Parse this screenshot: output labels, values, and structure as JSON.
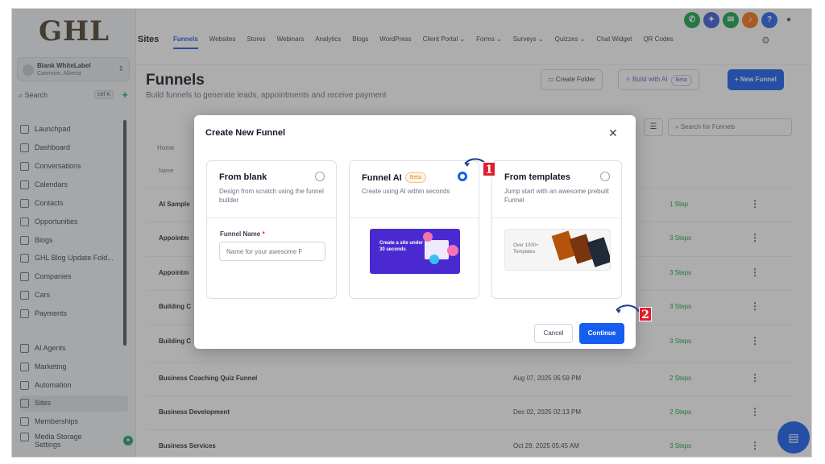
{
  "logo": "GHL",
  "account": {
    "name": "Blank WhiteLabel",
    "location": "Canmore, Alberta"
  },
  "sidebar_search": {
    "label": "Search",
    "shortcut": "ctrl K"
  },
  "sidebar": {
    "items": [
      {
        "label": "Launchpad"
      },
      {
        "label": "Dashboard"
      },
      {
        "label": "Conversations"
      },
      {
        "label": "Calendars"
      },
      {
        "label": "Contacts"
      },
      {
        "label": "Opportunities"
      },
      {
        "label": "Blogs"
      },
      {
        "label": "GHL Blog Update Fold..."
      },
      {
        "label": "Companies"
      },
      {
        "label": "Cars"
      },
      {
        "label": "Payments"
      },
      {
        "label": "AI Agents"
      },
      {
        "label": "Marketing"
      },
      {
        "label": "Automation"
      },
      {
        "label": "Sites"
      },
      {
        "label": "Memberships"
      },
      {
        "label": "Media Storage"
      },
      {
        "label": "Settings"
      }
    ]
  },
  "topbar": {
    "section": "Sites",
    "tabs": [
      "Funnels",
      "Websites",
      "Stores",
      "Webinars",
      "Analytics",
      "Blogs",
      "WordPress",
      "Client Portal ⌄",
      "Forms ⌄",
      "Surveys ⌄",
      "Quizzes ⌄",
      "Chat Widget",
      "QR Codes"
    ],
    "icons": [
      {
        "name": "phone",
        "glyph": "✆",
        "color": "#16a34a"
      },
      {
        "name": "sparkle",
        "glyph": "✦",
        "color": "#3b5bdb"
      },
      {
        "name": "megaphone",
        "glyph": "✉",
        "color": "#16a34a"
      },
      {
        "name": "bell",
        "glyph": "♪",
        "color": "#f97316"
      },
      {
        "name": "help",
        "glyph": "?",
        "color": "#2563eb"
      },
      {
        "name": "user",
        "glyph": "●",
        "color": "#4b5563"
      }
    ]
  },
  "page": {
    "title": "Funnels",
    "subtitle": "Build funnels to generate leads, appointments and receive payment",
    "create_folder": "Create Folder",
    "build_ai": "Build with AI",
    "build_ai_badge": "Beta",
    "new_funnel": "+ New Funnel",
    "search_placeholder": "Search for Funnels",
    "breadcrumb": "Home",
    "col_name": "Name"
  },
  "rows": [
    {
      "name": "AI Sample",
      "date": "",
      "steps": "1 Step"
    },
    {
      "name": "Appointm",
      "date": "",
      "steps": "3 Steps"
    },
    {
      "name": "Appointm",
      "date": "",
      "steps": "3 Steps"
    },
    {
      "name": "Building C",
      "date": "",
      "steps": "3 Steps"
    },
    {
      "name": "Building C",
      "date": "",
      "steps": "3 Steps"
    },
    {
      "name": "Business Coaching Quiz Funnel",
      "date": "Aug 07, 2025 05:59 PM",
      "steps": "2 Steps"
    },
    {
      "name": "Business Development",
      "date": "Dec 02, 2025 02:13 PM",
      "steps": "2 Steps"
    },
    {
      "name": "Business Services",
      "date": "Oct 29, 2025 05:45 AM",
      "steps": "3 Steps"
    }
  ],
  "modal": {
    "title": "Create New Funnel",
    "cards": [
      {
        "title": "From blank",
        "desc": "Design from scratch using the funnel builder"
      },
      {
        "title": "Funnel AI",
        "badge": "Beta",
        "desc": "Create using AI within seconds",
        "preview_text": "Create a site under 30 seconds"
      },
      {
        "title": "From templates",
        "desc": "Jump start with an awesome prebuilt Funnel",
        "preview_text": "Over 1000+ Templates"
      }
    ],
    "funnel_name_label": "Funnel Name",
    "funnel_name_required": "*",
    "funnel_name_placeholder": "Name for your awesome F",
    "selected_option": "Funnel AI",
    "cancel": "Cancel",
    "continue": "Continue"
  },
  "annotations": [
    "1",
    "2"
  ],
  "colors": {
    "primary": "#155eef",
    "success": "#16a34a",
    "annotation": "#e11d2e"
  }
}
